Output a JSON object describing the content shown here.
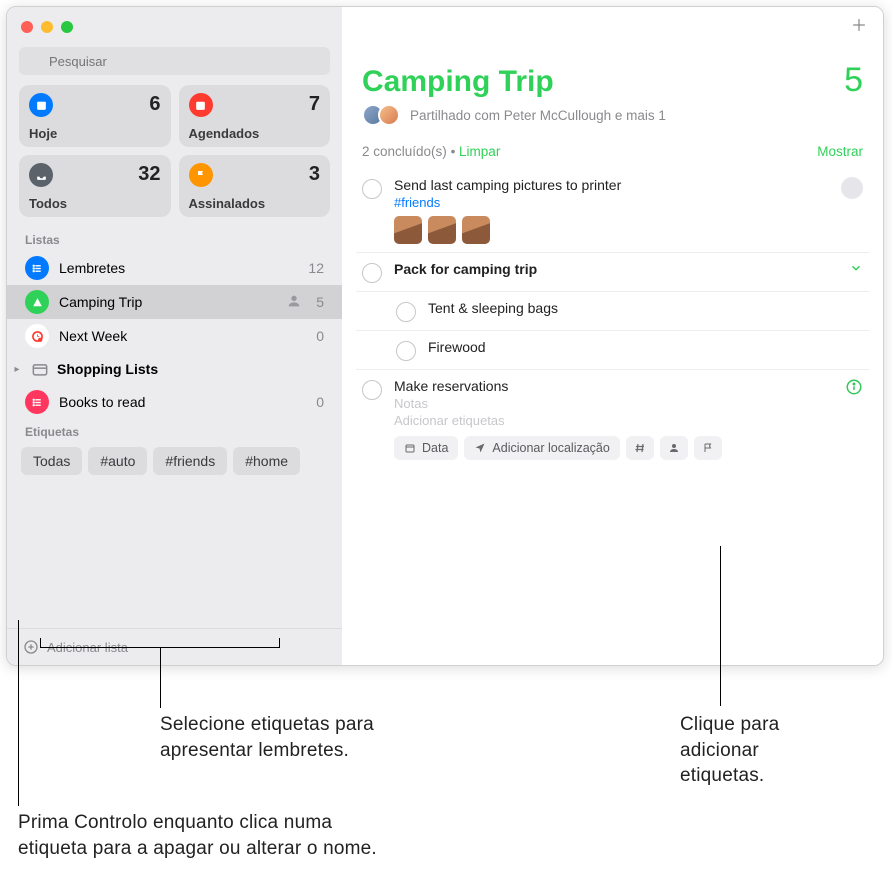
{
  "search": {
    "placeholder": "Pesquisar"
  },
  "smart": [
    {
      "label": "Hoje",
      "count": "6",
      "color": "bg-blue",
      "icon": "calendar"
    },
    {
      "label": "Agendados",
      "count": "7",
      "color": "bg-red",
      "icon": "calendar"
    },
    {
      "label": "Todos",
      "count": "32",
      "color": "bg-gray",
      "icon": "tray"
    },
    {
      "label": "Assinalados",
      "count": "3",
      "color": "bg-orange",
      "icon": "flag"
    }
  ],
  "sections": {
    "lists_title": "Listas",
    "tags_title": "Etiquetas"
  },
  "lists": [
    {
      "name": "Lembretes",
      "count": "12",
      "color": "bg-blue",
      "icon": "list",
      "selected": false,
      "shared": false
    },
    {
      "name": "Camping Trip",
      "count": "5",
      "color": "bg-green",
      "icon": "tent",
      "selected": true,
      "shared": true
    },
    {
      "name": "Next Week",
      "count": "0",
      "color": "bg-red",
      "icon": "clock",
      "selected": false,
      "shared": false
    }
  ],
  "folder": {
    "name": "Shopping Lists"
  },
  "extra_list": {
    "name": "Books to read",
    "count": "0",
    "color": "bg-pink",
    "icon": "list"
  },
  "tags": [
    "Todas",
    "#auto",
    "#friends",
    "#home"
  ],
  "add_list_label": "Adicionar lista",
  "main": {
    "title": "Camping Trip",
    "count": "5",
    "shared_text": "Partilhado com Peter McCullough e mais 1",
    "completed_text": "2 concluído(s)",
    "clear_label": "Limpar",
    "show_label": "Mostrar"
  },
  "reminders": [
    {
      "title": "Send last camping pictures to printer",
      "tag": "#friends",
      "has_thumbs": true,
      "has_assignee": true
    },
    {
      "title": "Pack for camping trip",
      "bold": true,
      "has_expand": true
    },
    {
      "title": "Tent & sleeping bags",
      "sub": true
    },
    {
      "title": "Firewood",
      "sub": true
    },
    {
      "title": "Make reservations",
      "editing": true,
      "notes_placeholder": "Notas",
      "tags_placeholder": "Adicionar etiquetas",
      "has_info": true
    }
  ],
  "toolbar": {
    "date": "Data",
    "location": "Adicionar localização"
  },
  "callouts": {
    "tags_select": "Selecione etiquetas para\napresentar lembretes.",
    "tags_control": "Prima Controlo enquanto clica numa\netiqueta para a apagar ou alterar o nome.",
    "add_tags": "Clique para\nadicionar\netiquetas."
  }
}
